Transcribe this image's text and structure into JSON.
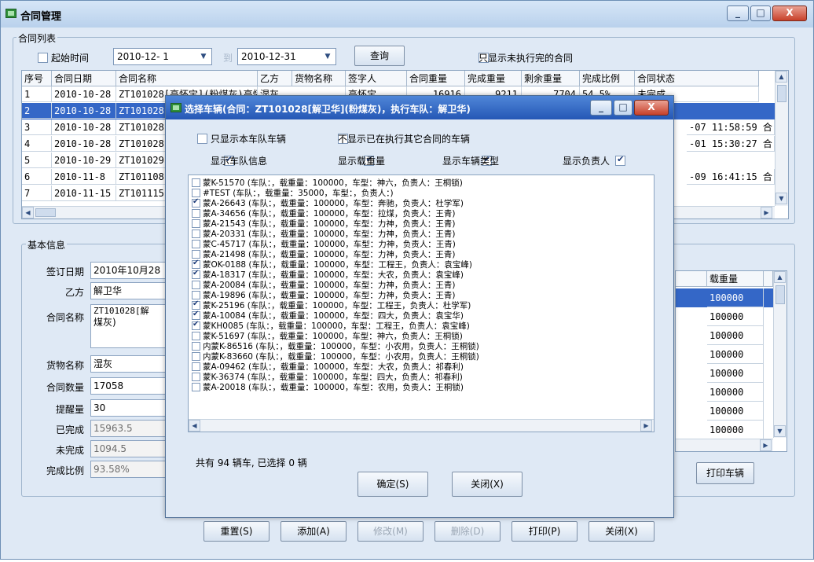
{
  "main_window": {
    "title": "合同管理",
    "controls": {
      "minimize": "_",
      "maximize": "□",
      "close": "X"
    }
  },
  "contract_list": {
    "group_label": "合同列表",
    "filters": {
      "start_time_label": "起始时间",
      "start_date": "2010-12- 1",
      "to_label": "到",
      "end_date": "2010-12-31",
      "query_button": "查询",
      "only_unfinished_label": "只显示未执行完的合同"
    },
    "columns": [
      "序号",
      "合同日期",
      "合同名称",
      "乙方",
      "货物名称",
      "签字人",
      "合同重量",
      "完成重量",
      "剩余重量",
      "完成比例",
      "合同状态"
    ],
    "rows": [
      {
        "no": "1",
        "date": "2010-10-28",
        "name": "ZT101028[高怀宝](粉煤灰)高怀宝",
        "party_goods": "湿灰",
        "signer": "高怀宝",
        "weight": "16916",
        "done": "9211",
        "remaining": "7704",
        "ratio": "54.5%",
        "status": "未完成"
      },
      {
        "no": "2",
        "date": "2010-10-28",
        "name": "ZT101028",
        "selected": true
      },
      {
        "no": "3",
        "date": "2010-10-28",
        "name": "ZT101028",
        "right_fragment": "-07 11:58:59 合"
      },
      {
        "no": "4",
        "date": "2010-10-28",
        "name": "ZT101028",
        "right_fragment": "-01 15:30:27 合"
      },
      {
        "no": "5",
        "date": "2010-10-29",
        "name": "ZT101029"
      },
      {
        "no": "6",
        "date": "2010-11-8",
        "name": "ZT101108",
        "right_fragment": "-09 16:41:15 合"
      },
      {
        "no": "7",
        "date": "2010-11-15",
        "name": "ZT101115"
      }
    ]
  },
  "basic_info": {
    "group_label": "基本信息",
    "fields": {
      "sign_date": {
        "label": "签订日期",
        "value": "2010年10月28"
      },
      "party_b": {
        "label": "乙方",
        "value": "解卫华"
      },
      "contract_name": {
        "label": "合同名称",
        "value_line1": "ZT101028[解",
        "value_line2": "煤灰)"
      },
      "goods": {
        "label": "货物名称",
        "value": "湿灰"
      },
      "quantity": {
        "label": "合同数量",
        "value": "17058"
      },
      "reminder": {
        "label": "提醒量",
        "value": "30"
      },
      "completed": {
        "label": "已完成",
        "value": "15963.5"
      },
      "uncompleted": {
        "label": "未完成",
        "value": "1094.5"
      },
      "ratio": {
        "label": "完成比例",
        "value": "93.58%"
      }
    },
    "vehicle_grid": {
      "header": "载重量",
      "values": [
        "100000",
        "100000",
        "100000",
        "100000",
        "100000",
        "100000",
        "100000",
        "100000"
      ],
      "print_button": "打印车辆"
    }
  },
  "bottom_buttons": [
    "重置(S)",
    "添加(A)",
    "修改(M)",
    "删除(D)",
    "打印(P)",
    "关闭(X)"
  ],
  "dialog": {
    "title": "选择车辆(合同：ZT101028[解卫华](粉煤灰)，执行车队：解卫华)",
    "options": [
      {
        "label": "只显示本车队车辆",
        "checked": false
      },
      {
        "label": "不显示已在执行其它合同的车辆",
        "checked": false
      },
      {
        "label": "显示车队信息",
        "checked": true
      },
      {
        "label": "显示载重量",
        "checked": true
      },
      {
        "label": "显示车辆类型",
        "checked": true
      },
      {
        "label": "显示负责人",
        "checked": true
      }
    ],
    "vehicles": [
      {
        "text": "蒙K-51570  (车队：，载重量：100000，车型：神六，负责人：王桐锁)",
        "checked": false
      },
      {
        "text": "#TEST  (车队：，载重量：35000，车型：，负责人：)",
        "checked": false
      },
      {
        "text": "蒙A-26643  (车队：，载重量：100000，车型：奔驰，负责人：杜学军)",
        "checked": true
      },
      {
        "text": "蒙A-34656  (车队：，载重量：100000，车型：拉煤，负责人：王青)",
        "checked": false
      },
      {
        "text": "蒙A-21543  (车队：，载重量：100000，车型：力神，负责人：王青)",
        "checked": false
      },
      {
        "text": "蒙A-20331  (车队：，载重量：100000，车型：力神，负责人：王青)",
        "checked": false
      },
      {
        "text": "蒙C-45717  (车队：，载重量：100000，车型：力神，负责人：王青)",
        "checked": false
      },
      {
        "text": "蒙A-21498  (车队：，载重量：100000，车型：力神，负责人：王青)",
        "checked": false
      },
      {
        "text": "蒙OK-0188  (车队：，载重量：100000，车型：工程王，负责人：袁宝峰)",
        "checked": true
      },
      {
        "text": "蒙A-18317  (车队：，载重量：100000，车型：大农，负责人：袁宝峰)",
        "checked": true
      },
      {
        "text": "蒙A-20084  (车队：，载重量：100000，车型：力神，负责人：王青)",
        "checked": false
      },
      {
        "text": "蒙A-19896  (车队：，载重量：100000，车型：力神，负责人：王青)",
        "checked": false
      },
      {
        "text": "蒙K-25196  (车队：，载重量：100000，车型：工程王，负责人：杜学军)",
        "checked": true
      },
      {
        "text": "蒙A-10084  (车队：，载重量：100000，车型：四大，负责人：袁宝华)",
        "checked": true
      },
      {
        "text": "蒙KH0085  (车队：，载重量：100000，车型：工程王，负责人：袁宝峰)",
        "checked": true
      },
      {
        "text": "蒙K-51697  (车队：，载重量：100000，车型：神六，负责人：王桐锁)",
        "checked": false
      },
      {
        "text": "内蒙K-86516  (车队：，载重量：100000，车型：小农用，负责人：王桐锁)",
        "checked": false
      },
      {
        "text": "内蒙K-83660  (车队：，载重量：100000，车型：小农用，负责人：王桐锁)",
        "checked": false
      },
      {
        "text": "蒙A-09462  (车队：，载重量：100000，车型：大农，负责人：祁春利)",
        "checked": false
      },
      {
        "text": "蒙K-36374  (车队：，载重量：100000，车型：四大，负责人：祁春利)",
        "checked": false
      },
      {
        "text": "蒙A-20018  (车队：，载重量：100000，车型：农用，负责人：王桐锁)",
        "checked": false
      }
    ],
    "summary": "共有 94 辆车, 已选择 0 辆",
    "ok_button": "确定(S)",
    "close_button": "关闭(X)"
  }
}
